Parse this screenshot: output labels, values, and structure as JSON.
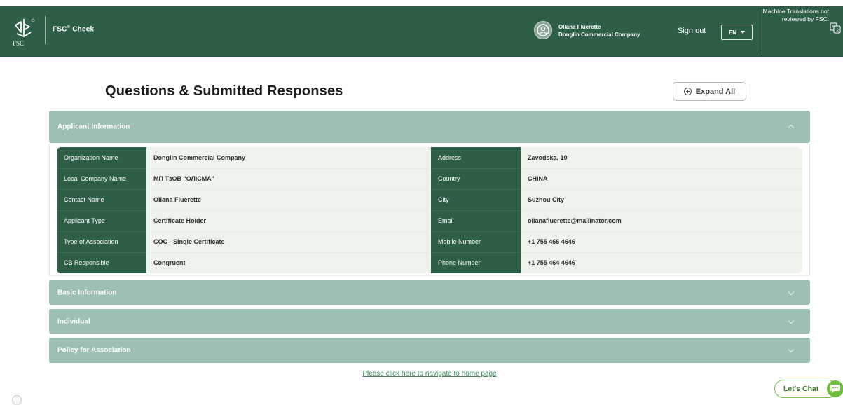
{
  "header": {
    "logo_text": "FSC",
    "app_title": "FSC",
    "app_title_mark": "®",
    "app_title_rest": " Check",
    "user_name": "Oliana Fluerette",
    "user_company": "Donglin Commercial Company",
    "sign_out": "Sign out",
    "language": "EN",
    "machine_translation_note": "Machine Translations not reviewed by FSC:"
  },
  "page": {
    "title": "Questions & Submitted Responses",
    "expand_all": "Expand All"
  },
  "sections": {
    "applicant": "Applicant Information",
    "basic": "Basic Information",
    "individual": "Individual",
    "policy": "Policy for Association"
  },
  "applicant_rows": [
    {
      "k1": "Organization Name",
      "v1": "Donglin Commercial Company",
      "k2": "Address",
      "v2": "Zavodska, 10"
    },
    {
      "k1": "Local Company Name",
      "v1": "МП ТзОВ \"ОЛІСМА\"",
      "k2": "Country",
      "v2": "CHINA"
    },
    {
      "k1": "Contact Name",
      "v1": "Oliana Fluerette",
      "k2": "City",
      "v2": "Suzhou City"
    },
    {
      "k1": "Applicant Type",
      "v1": "Certificate Holder",
      "k2": "Email",
      "v2": "olianafluerette@mailinator.com"
    },
    {
      "k1": "Type of Association",
      "v1": "COC - Single Certificate",
      "k2": "Mobile Number",
      "v2": "+1 755 466 4646"
    },
    {
      "k1": "CB Responsible",
      "v1": "Congruent",
      "k2": "Phone Number",
      "v2": "+1 755 464 4646"
    }
  ],
  "footer": {
    "home_link": "Please click here to navigate to home page",
    "chat": "Let's Chat"
  },
  "colors": {
    "brand_green": "#2f5e46",
    "accordion_green": "#9cc0b3",
    "value_bg": "#eef3ec",
    "chat_green": "#6fbe3a"
  }
}
